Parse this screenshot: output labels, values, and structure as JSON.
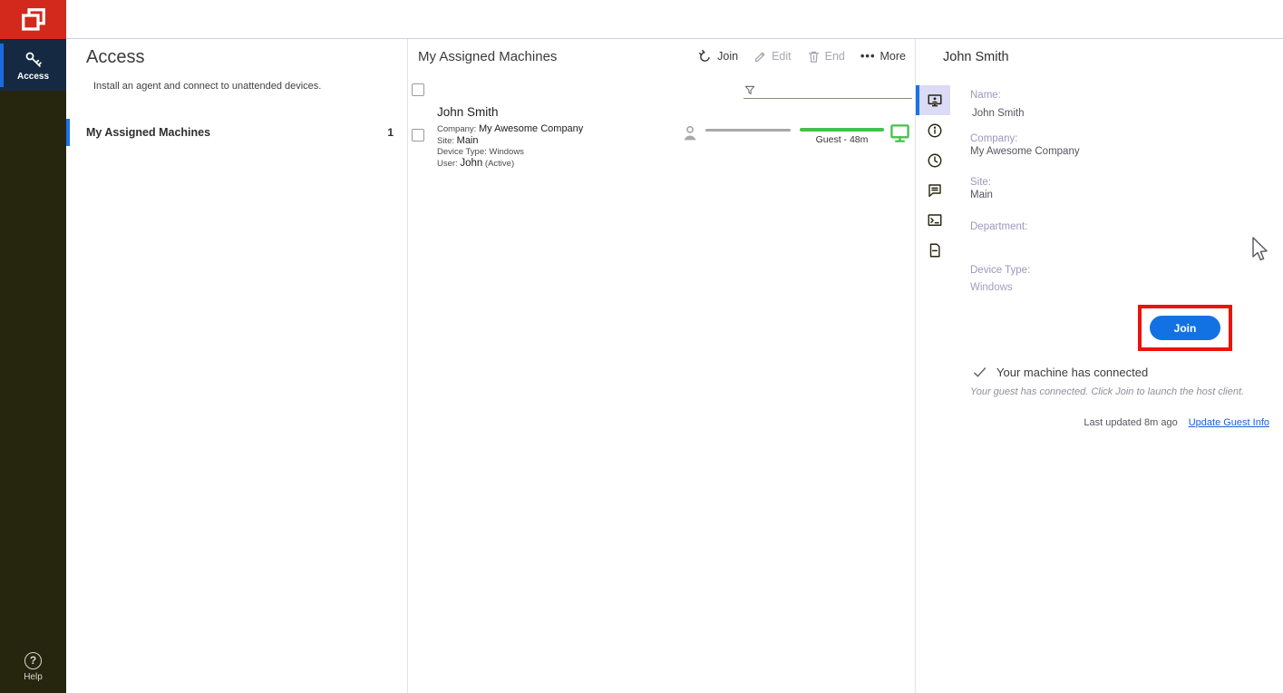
{
  "colors": {
    "brand_red": "#d3281c",
    "sidebar_bg": "#26260f",
    "accent_blue": "#1a73e8",
    "join_blue": "#1272e4",
    "session_green": "#44c14a",
    "highlight_red": "#ec130b"
  },
  "sidebar": {
    "access_label": "Access",
    "help_label": "Help"
  },
  "left_panel": {
    "title": "Access",
    "subtitle": "Install an agent and connect to unattended devices.",
    "items": [
      {
        "label": "My Assigned Machines",
        "count": "1"
      }
    ]
  },
  "machines_panel": {
    "title": "My Assigned Machines",
    "toolbar": {
      "join": "Join",
      "edit": "Edit",
      "end": "End",
      "more": "More"
    },
    "filter_value": "",
    "row": {
      "name": "John Smith",
      "company_label": "Company:",
      "company": "My Awesome Company",
      "site_label": "Site:",
      "site": "Main",
      "device_label": "Device Type:",
      "device": "Windows",
      "user_label": "User:",
      "user": "John",
      "user_state": "(Active)",
      "session_badge": "Guest - 48m"
    }
  },
  "detail_panel": {
    "title": "John Smith",
    "tabs": [
      "start",
      "info",
      "timeline",
      "messages",
      "commands",
      "notes"
    ],
    "fields": {
      "name_label": "Name:",
      "name": "John Smith",
      "company_label": "Company:",
      "company": "My Awesome Company",
      "site_label": "Site:",
      "site": "Main",
      "department_label": "Department:",
      "department": "",
      "device_label": "Device Type:",
      "device": "Windows"
    },
    "join_button": "Join",
    "status_title": "Your machine has connected",
    "status_desc": "Your guest has connected. Click Join to launch the host client.",
    "last_updated": "Last updated 8m ago",
    "update_link": "Update Guest Info"
  }
}
